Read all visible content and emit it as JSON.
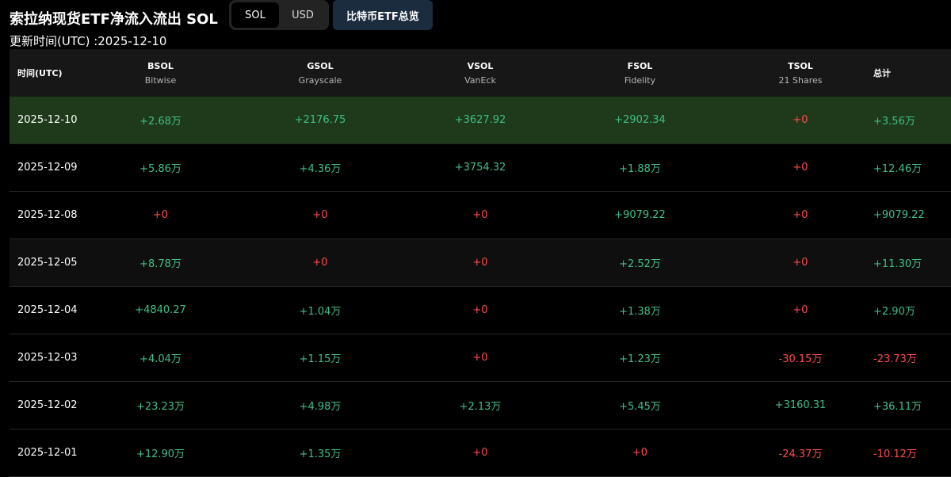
{
  "header": {
    "title": "索拉纳现货ETF净流入流出 SOL",
    "toggle": {
      "options": [
        "SOL",
        "USD"
      ],
      "selected": "SOL"
    },
    "overview_button": "比特币ETF总览",
    "updated": "更新时间(UTC) :2025-12-10"
  },
  "table": {
    "columns": [
      {
        "title": "时间(UTC)",
        "sub": ""
      },
      {
        "title": "BSOL",
        "sub": "Bitwise"
      },
      {
        "title": "GSOL",
        "sub": "Grayscale"
      },
      {
        "title": "VSOL",
        "sub": "VanEck"
      },
      {
        "title": "FSOL",
        "sub": "Fidelity"
      },
      {
        "title": "TSOL",
        "sub": "21 Shares"
      },
      {
        "title": "总计",
        "sub": ""
      }
    ],
    "rows": [
      {
        "date": "2025-12-10",
        "values": [
          "+2.68万",
          "+2176.75",
          "+3627.92",
          "+2902.34",
          "+0",
          "+3.56万"
        ],
        "colors": [
          "pos",
          "pos",
          "pos",
          "pos",
          "neg",
          "pos"
        ]
      },
      {
        "date": "2025-12-09",
        "values": [
          "+5.86万",
          "+4.36万",
          "+3754.32",
          "+1.88万",
          "+0",
          "+12.46万"
        ],
        "colors": [
          "pos",
          "pos",
          "pos",
          "pos",
          "neg",
          "pos"
        ]
      },
      {
        "date": "2025-12-08",
        "values": [
          "+0",
          "+0",
          "+0",
          "+9079.22",
          "+0",
          "+9079.22"
        ],
        "colors": [
          "neg",
          "neg",
          "neg",
          "pos",
          "neg",
          "pos"
        ]
      },
      {
        "date": "2025-12-05",
        "values": [
          "+8.78万",
          "+0",
          "+0",
          "+2.52万",
          "+0",
          "+11.30万"
        ],
        "colors": [
          "pos",
          "neg",
          "neg",
          "pos",
          "neg",
          "pos"
        ]
      },
      {
        "date": "2025-12-04",
        "values": [
          "+4840.27",
          "+1.04万",
          "+0",
          "+1.38万",
          "+0",
          "+2.90万"
        ],
        "colors": [
          "pos",
          "pos",
          "neg",
          "pos",
          "neg",
          "pos"
        ]
      },
      {
        "date": "2025-12-03",
        "values": [
          "+4.04万",
          "+1.15万",
          "+0",
          "+1.23万",
          "-30.15万",
          "-23.73万"
        ],
        "colors": [
          "pos",
          "pos",
          "neg",
          "pos",
          "neg",
          "neg"
        ]
      },
      {
        "date": "2025-12-02",
        "values": [
          "+23.23万",
          "+4.98万",
          "+2.13万",
          "+5.45万",
          "+3160.31",
          "+36.11万"
        ],
        "colors": [
          "pos",
          "pos",
          "pos",
          "pos",
          "pos",
          "pos"
        ]
      },
      {
        "date": "2025-12-01",
        "values": [
          "+12.90万",
          "+1.35万",
          "+0",
          "+0",
          "-24.37万",
          "-10.12万"
        ],
        "colors": [
          "pos",
          "pos",
          "neg",
          "neg",
          "neg",
          "neg"
        ]
      }
    ]
  },
  "colors": {
    "positive": "#3fbf86",
    "negative": "#ff4b4b",
    "highlight_row": "#1f3a1b",
    "header_bg": "#171717",
    "overview_button_bg": "#1c2c3f"
  }
}
